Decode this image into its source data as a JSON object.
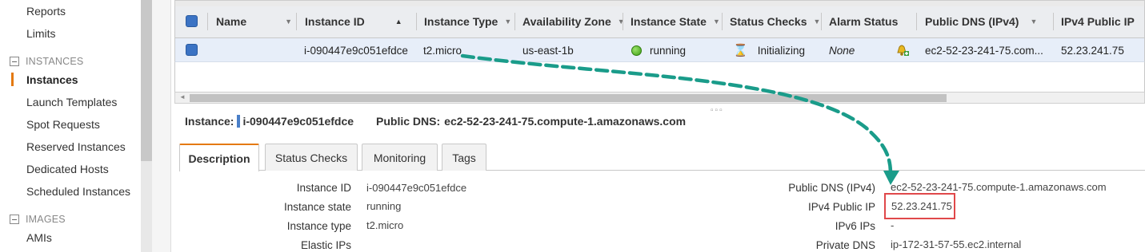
{
  "sidebar": {
    "items_top": [
      {
        "label": "Reports"
      },
      {
        "label": "Limits"
      }
    ],
    "sections": [
      {
        "title": "INSTANCES",
        "items": [
          {
            "label": "Instances",
            "active": true
          },
          {
            "label": "Launch Templates"
          },
          {
            "label": "Spot Requests"
          },
          {
            "label": "Reserved Instances"
          },
          {
            "label": "Dedicated Hosts"
          },
          {
            "label": "Scheduled Instances"
          }
        ]
      },
      {
        "title": "IMAGES",
        "items": [
          {
            "label": "AMIs"
          }
        ]
      }
    ]
  },
  "table": {
    "columns": [
      {
        "label": "Name",
        "sort": "caret"
      },
      {
        "label": "Instance ID",
        "sort": "asc"
      },
      {
        "label": "Instance Type",
        "sort": "caret"
      },
      {
        "label": "Availability Zone",
        "sort": "caret"
      },
      {
        "label": "Instance State",
        "sort": "caret"
      },
      {
        "label": "Status Checks",
        "sort": "caret"
      },
      {
        "label": "Alarm Status",
        "sort": "none"
      },
      {
        "label": "Public DNS (IPv4)",
        "sort": "caret"
      },
      {
        "label": "IPv4 Public IP",
        "sort": "none"
      }
    ],
    "row": {
      "name": "",
      "instance_id": "i-090447e9c051efdce",
      "instance_type": "t2.micro",
      "availability_zone": "us-east-1b",
      "instance_state": "running",
      "status_checks": "Initializing",
      "alarm_status": "None",
      "public_dns": "ec2-52-23-241-75.com...",
      "ipv4_public_ip": "52.23.241.75"
    }
  },
  "detail": {
    "instance_label": "Instance:",
    "instance_id": "i-090447e9c051efdce",
    "public_dns_label": "Public DNS:",
    "public_dns": "ec2-52-23-241-75.compute-1.amazonaws.com",
    "tabs": [
      {
        "label": "Description",
        "active": true
      },
      {
        "label": "Status Checks"
      },
      {
        "label": "Monitoring"
      },
      {
        "label": "Tags"
      }
    ],
    "left_fields": [
      {
        "label": "Instance ID",
        "value": "i-090447e9c051efdce"
      },
      {
        "label": "Instance state",
        "value": "running"
      },
      {
        "label": "Instance type",
        "value": "t2.micro"
      },
      {
        "label": "Elastic IPs",
        "value": ""
      }
    ],
    "right_fields": [
      {
        "label": "Public DNS (IPv4)",
        "value": "ec2-52-23-241-75.compute-1.amazonaws.com"
      },
      {
        "label": "IPv4 Public IP",
        "value": "52.23.241.75"
      },
      {
        "label": "IPv6 IPs",
        "value": "-"
      },
      {
        "label": "Private DNS",
        "value": "ip-172-31-57-55.ec2.internal"
      }
    ]
  },
  "colors": {
    "accent_orange": "#e47911",
    "selected_row": "#e7eef9",
    "arrow_teal": "#1a9c8a",
    "highlight_red": "#e0484a"
  },
  "icons": {
    "state": "green-circle-icon",
    "status": "hourglass-icon",
    "alarm": "bell-plus-icon"
  }
}
